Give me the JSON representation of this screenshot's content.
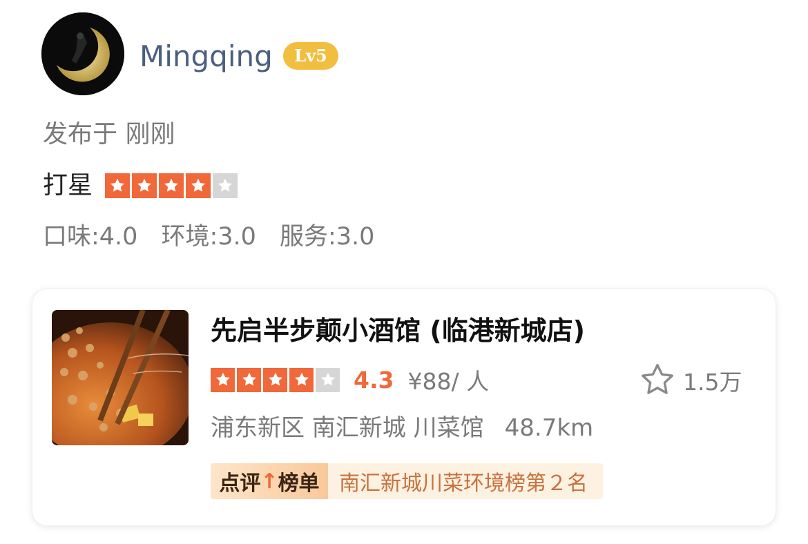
{
  "author": {
    "name": "Mingqing",
    "level": "Lv5",
    "avatar_icon": "moon-avatar-icon"
  },
  "post": {
    "time_text": "发布于 刚刚",
    "rating_label": "打星",
    "rating_stars": 4,
    "rating_stars_max": 5,
    "sub_scores": [
      {
        "label": "口味:4.0"
      },
      {
        "label": "环境:3.0"
      },
      {
        "label": "服务:3.0"
      }
    ]
  },
  "shop": {
    "name": "先启半步颠小酒馆 (临港新城店)",
    "stars": 4,
    "stars_max": 5,
    "score": "4.3",
    "price": "¥88/ 人",
    "favorites": "1.5万",
    "favorite_icon": "star-outline-icon",
    "location": "浦东新区 南汇新城 川菜馆",
    "distance": "48.7km",
    "rank_badge_prefix": "点评",
    "rank_badge_arrow": "↑",
    "rank_badge_suffix": "榜单",
    "rank_text": "南汇新城川菜环境榜第２名"
  },
  "colors": {
    "accent": "#f1683b",
    "username": "#4a5f80",
    "level_badge": "#f2be3f",
    "muted": "#7a7a7a"
  }
}
